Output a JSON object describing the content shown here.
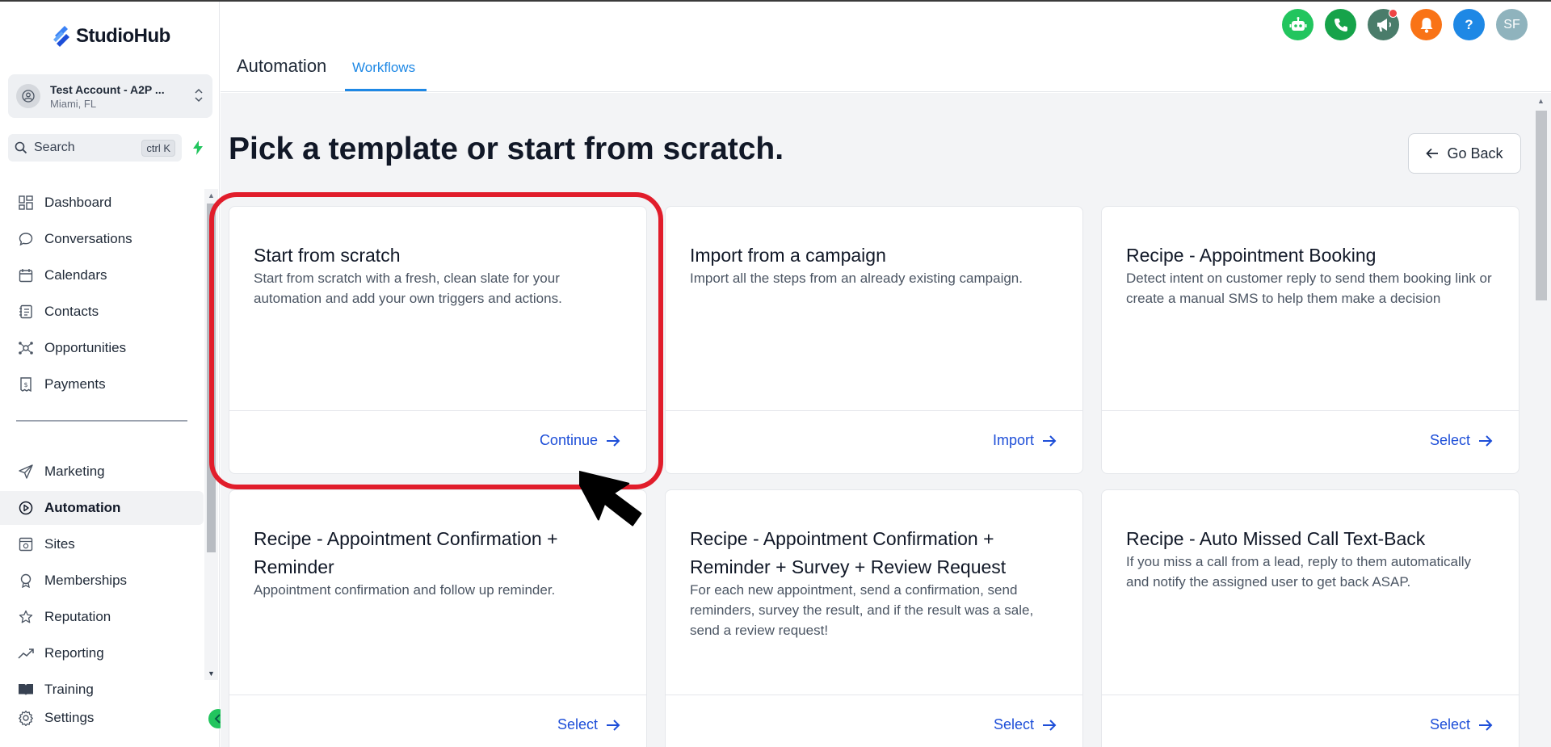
{
  "app": {
    "brand": "StudioHub",
    "accent": "#1e88e5"
  },
  "account": {
    "name": "Test Account - A2P ...",
    "location": "Miami, FL"
  },
  "search": {
    "label": "Search",
    "shortcut": "ctrl K"
  },
  "sidebar": {
    "items": [
      {
        "label": "Dashboard",
        "icon": "grid-icon"
      },
      {
        "label": "Conversations",
        "icon": "chat-bubble-icon"
      },
      {
        "label": "Calendars",
        "icon": "calendar-icon"
      },
      {
        "label": "Contacts",
        "icon": "contact-card-icon"
      },
      {
        "label": "Opportunities",
        "icon": "opportunities-icon"
      },
      {
        "label": "Payments",
        "icon": "payments-icon"
      },
      {
        "label": "Marketing",
        "icon": "paper-plane-icon"
      },
      {
        "label": "Automation",
        "icon": "automation-icon",
        "active": true
      },
      {
        "label": "Sites",
        "icon": "sites-icon"
      },
      {
        "label": "Memberships",
        "icon": "memberships-icon"
      },
      {
        "label": "Reputation",
        "icon": "star-icon"
      },
      {
        "label": "Reporting",
        "icon": "trend-icon"
      },
      {
        "label": "Training",
        "icon": "book-icon"
      }
    ],
    "settings_label": "Settings"
  },
  "header": {
    "title": "Automation",
    "tab": "Workflows",
    "avatar_initials": "SF",
    "icons": [
      {
        "name": "bot-icon",
        "color": "#22c55e"
      },
      {
        "name": "phone-icon",
        "color": "#16a34a"
      },
      {
        "name": "megaphone-icon",
        "color": "#4a7c6a"
      },
      {
        "name": "bell-icon",
        "color": "#f97316"
      },
      {
        "name": "help-icon",
        "color": "#1e88e5",
        "text": "?"
      },
      {
        "name": "avatar",
        "color": "#8fb3bd"
      }
    ]
  },
  "main": {
    "heading": "Pick a template or start from scratch.",
    "go_back": "Go Back",
    "cards": [
      {
        "title": "Start from scratch",
        "desc": "Start from scratch with a fresh, clean slate for your automation and add your own triggers and actions.",
        "action": "Continue"
      },
      {
        "title": "Import from a campaign",
        "desc": "Import all the steps from an already existing campaign.",
        "action": "Import"
      },
      {
        "title": "Recipe - Appointment Booking",
        "desc": "Detect intent on customer reply to send them booking link or create a manual SMS to help them make a decision",
        "action": "Select"
      },
      {
        "title": "Recipe - Appointment Confirmation + Reminder",
        "desc": "Appointment confirmation and follow up reminder.",
        "action": "Select"
      },
      {
        "title": "Recipe - Appointment Confirmation + Reminder + Survey + Review Request",
        "desc": "For each new appointment, send a confirmation, send reminders, survey the result, and if the result was a sale, send a review request!",
        "action": "Select"
      },
      {
        "title": "Recipe - Auto Missed Call Text-Back",
        "desc": "If you miss a call from a lead, reply to them automatically and notify the assigned user to get back ASAP.",
        "action": "Select"
      }
    ]
  },
  "annotation": {
    "highlight_color": "#e11d2b"
  }
}
